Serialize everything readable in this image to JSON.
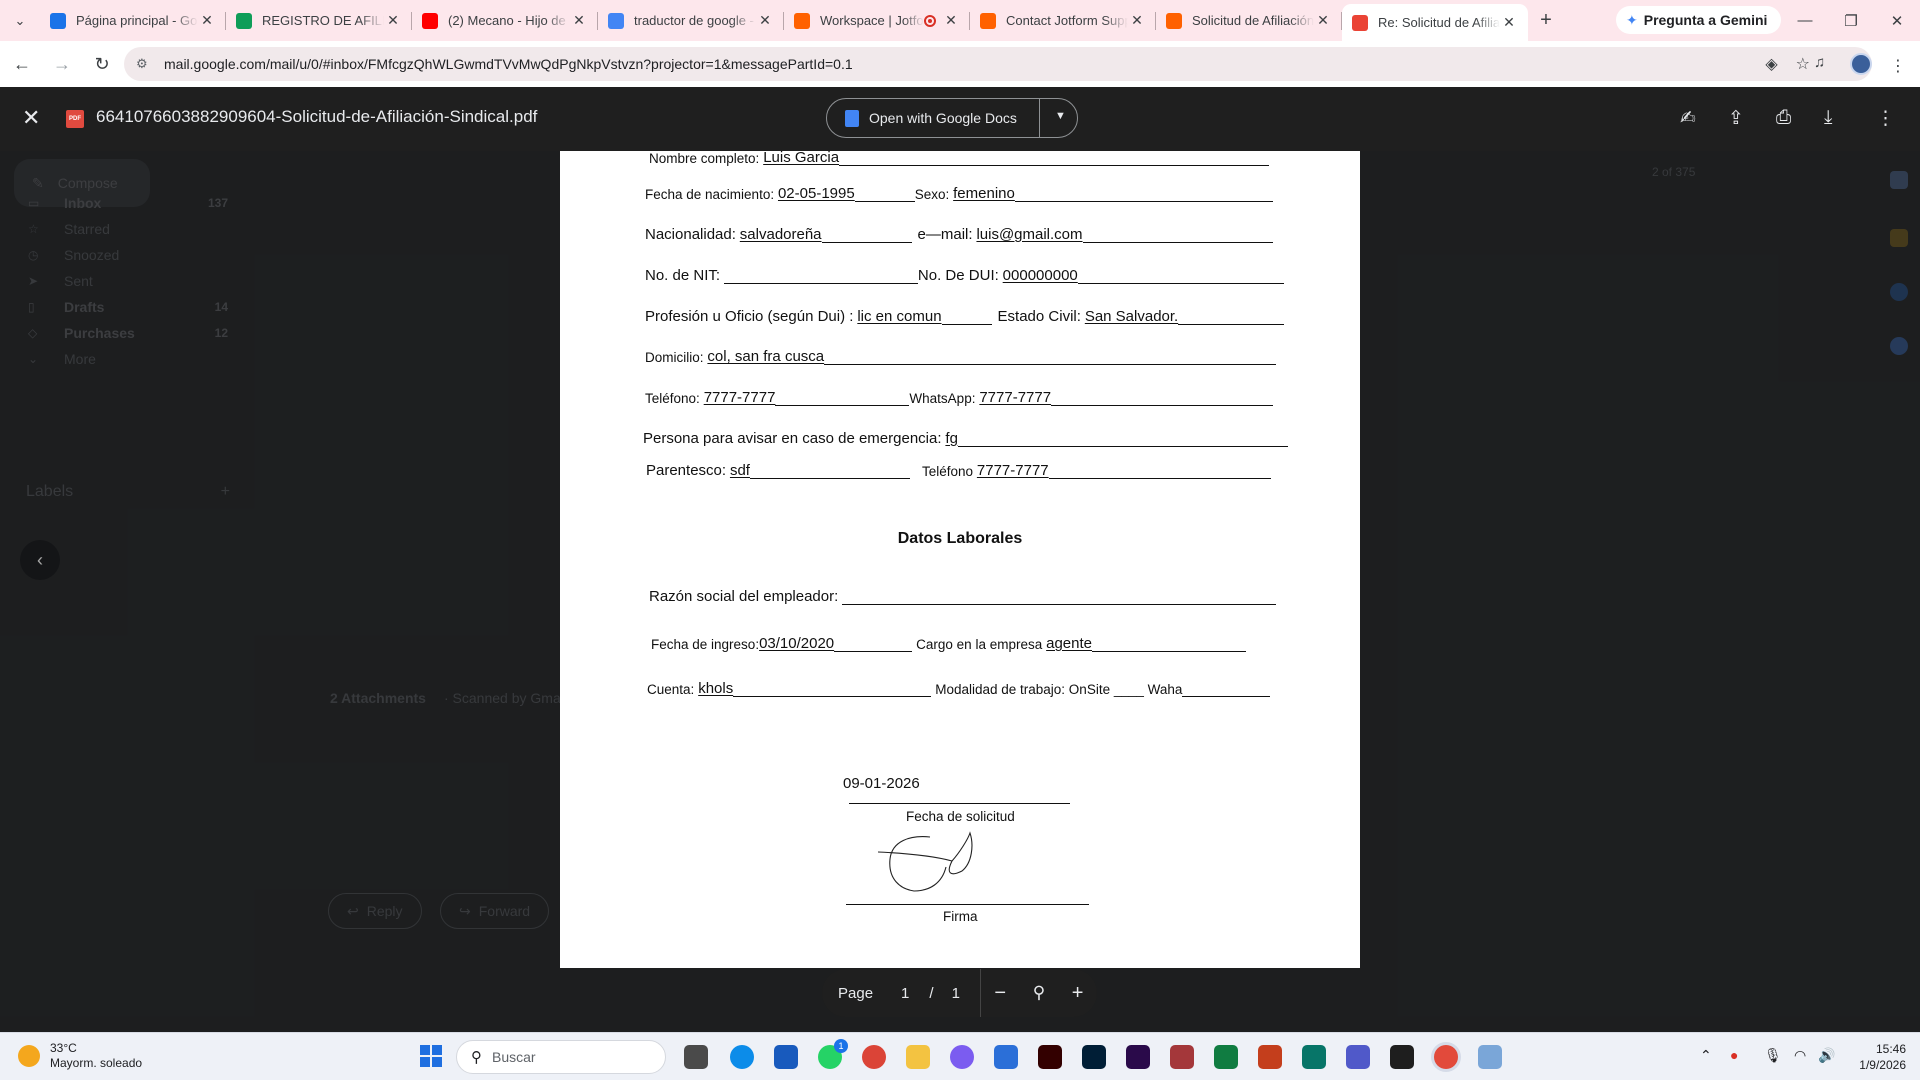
{
  "browser": {
    "tabs": [
      {
        "title": "Página principal - Goo",
        "favicon_color": "#1a73e8",
        "active": false
      },
      {
        "title": "REGISTRO DE AFILIAC",
        "favicon_color": "#0f9d58",
        "active": false
      },
      {
        "title": "(2) Mecano - Hijo de",
        "favicon_color": "#ff0000",
        "active": false
      },
      {
        "title": "traductor de google -",
        "favicon_color": "#4285f4",
        "active": false
      },
      {
        "title": "Workspace | Jotfo",
        "favicon_color": "#ff6100",
        "active": false,
        "recording": true
      },
      {
        "title": "Contact Jotform Supp",
        "favicon_color": "#ff6100",
        "active": false
      },
      {
        "title": "Solicitud de Afiliación",
        "favicon_color": "#ff6100",
        "active": false
      },
      {
        "title": "Re: Solicitud de Afilia",
        "favicon_color": "#ea4335",
        "active": true
      }
    ],
    "gemini_label": "Pregunta a Gemini",
    "url": "mail.google.com/mail/u/0/#inbox/FMfcgzQhWLGwmdTVvMwQdPgNkpVstvzn?projector=1&messagePartId=0.1"
  },
  "gmail": {
    "compose_label": "Compose",
    "sidebar": [
      {
        "label": "Inbox",
        "count": "137",
        "bold": true
      },
      {
        "label": "Starred",
        "count": ""
      },
      {
        "label": "Snoozed",
        "count": ""
      },
      {
        "label": "Sent",
        "count": ""
      },
      {
        "label": "Drafts",
        "count": "14",
        "bold": true
      },
      {
        "label": "Purchases",
        "count": "12",
        "bold": true
      },
      {
        "label": "More",
        "count": ""
      }
    ],
    "labels_heading": "Labels",
    "pager_text": "2 of 375",
    "attachments_text": "2 Attachments",
    "scanned_text": "· Scanned by Gmai",
    "reply_label": "Reply",
    "forward_label": "Forward"
  },
  "viewer": {
    "filename": "6641076603882909604-Solicitud-de-Afiliación-Sindical.pdf",
    "open_with_label": "Open with Google Docs",
    "page_label": "Page",
    "current_page": "1",
    "page_separator": "/",
    "total_pages": "1"
  },
  "form": {
    "nombre_label": "Nombre completo:",
    "nombre_value": "Luis Garcia",
    "nacimiento_label": "Fecha de nacimiento:",
    "nacimiento_value": "02-05-1995",
    "sexo_label": "Sexo:",
    "sexo_value": "femenino",
    "nacionalidad_label": "Nacionalidad:",
    "nacionalidad_value": "salvadoreña",
    "email_label": "e—mail:",
    "email_value": "luis@gmail.com",
    "nit_label": "No. de NIT:",
    "dui_label": "No. De DUI:",
    "dui_value": "000000000",
    "profesion_label": "Profesión u Oficio (según Dui) :",
    "profesion_value": "lic en comun",
    "civil_label": "Estado Civil:",
    "civil_value": "San Salvador.",
    "domicilio_label": "Domicilio:",
    "domicilio_value": "col, san fra cusca",
    "telefono_label": "Teléfono:",
    "telefono_value": "7777-7777",
    "whatsapp_label": "WhatsApp:",
    "whatsapp_value": "7777-7777",
    "emergencia_label": "Persona para avisar en caso de emergencia:",
    "emergencia_value": "fg",
    "parentesco_label": "Parentesco:",
    "parentesco_value": "sdf",
    "telefono2_label": "Teléfono",
    "telefono2_value": "7777-7777",
    "laborales_title": "Datos Laborales",
    "razon_label": "Razón social del empleador:",
    "ingreso_label": "Fecha de ingreso:",
    "ingreso_value": "03/10/2020",
    "cargo_label": "Cargo en la empresa",
    "cargo_value": "agente",
    "cuenta_label": "Cuenta:",
    "cuenta_value": "khols",
    "modalidad_label": "Modalidad de trabajo: OnSite ____ Waha",
    "fecha_solicitud_value": "09-01-2026",
    "fecha_solicitud_label": "Fecha de solicitud",
    "firma_label": "Firma"
  },
  "taskbar": {
    "temperature": "33°C",
    "weather": "Mayorm. soleado",
    "search_placeholder": "Buscar",
    "time": "15:46",
    "date": "1/9/2026",
    "whatsapp_badge": "1"
  }
}
